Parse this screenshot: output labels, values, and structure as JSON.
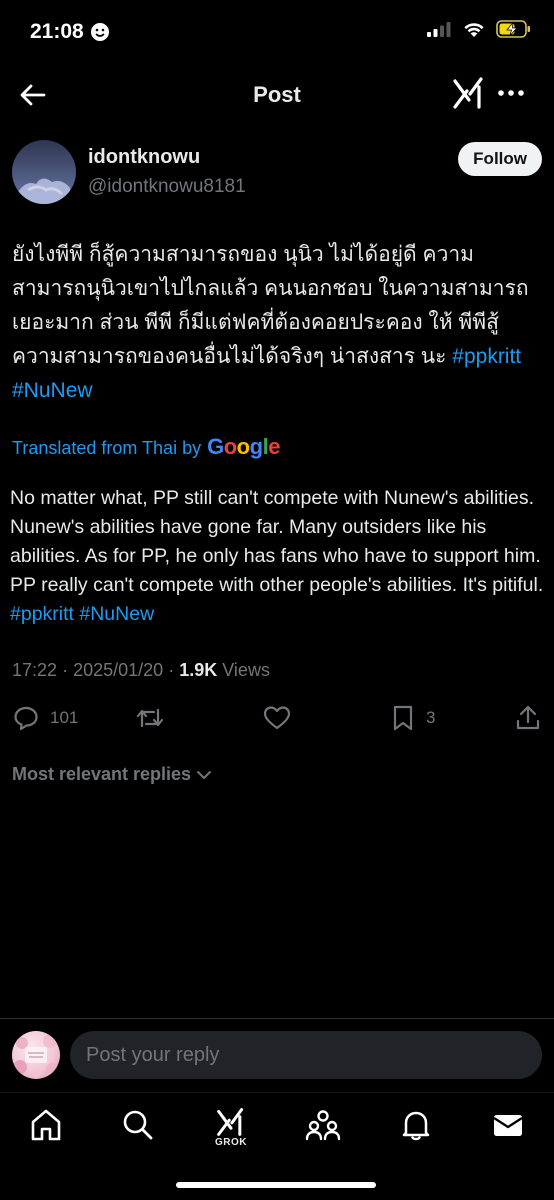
{
  "status_bar": {
    "time": "21:08"
  },
  "topbar": {
    "title": "Post"
  },
  "author": {
    "display_name": "idontknowu",
    "handle": "@idontknowu8181",
    "follow_label": "Follow"
  },
  "post": {
    "thai_text": "ยังไงพีพี ก็สู้ความสามารถของ นุนิว ไม่ได้อยู่ดี ความสามารถนุนิวเขาไปไกลแล้ว คนนอกชอบ ในความสามารถเยอะมาก ส่วน พีพี ก็มีแต่ฟคที่ต้องคอยประคอง ให้ พีพีสู้ความสามารถของคนอื่นไม่ได้จริงๆ น่าสงสาร นะ ",
    "hashtags": [
      "#ppkritt",
      "#NuNew"
    ],
    "translated_label": "Translated from Thai by",
    "translated_brand": "Google",
    "translation_text": "No matter what, PP still can't compete with Nunew's abilities. Nunew's abilities have gone far. Many outsiders like his abilities. As for PP, he only has fans who have to support him. PP really can't compete with other people's abilities. It's pitiful. ",
    "time": "17:22",
    "separator": "·",
    "date": "2025/01/20",
    "views_count": "1.9K",
    "views_label": "Views"
  },
  "actions": {
    "replies": "101",
    "reposts": "",
    "likes": "",
    "bookmarks": "3"
  },
  "replies_filter": "Most relevant replies",
  "reply_box": {
    "placeholder": "Post your reply"
  },
  "tabbar": {
    "grok_label": "GROK"
  }
}
